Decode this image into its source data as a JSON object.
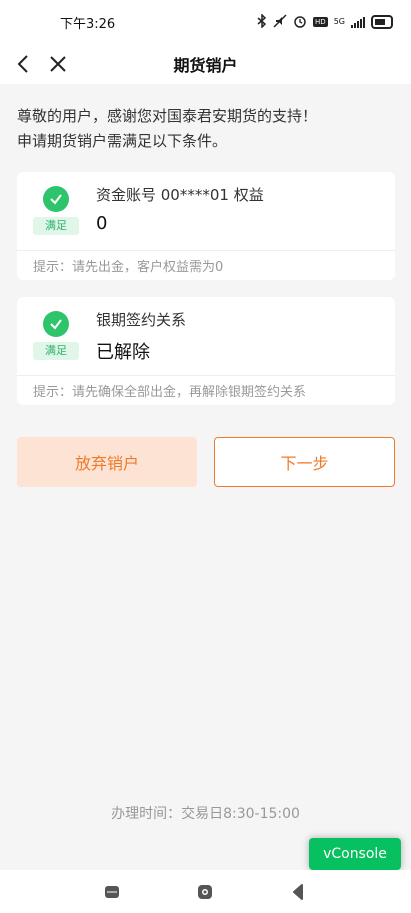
{
  "status_bar": {
    "time": "下午3:26",
    "network": "5G",
    "hd": "HD"
  },
  "nav": {
    "title": "期货销户",
    "back_icon": "back-arrow-icon",
    "close_icon": "close-icon"
  },
  "intro": {
    "line1": "尊敬的用户，感谢您对国泰君安期货的支持！",
    "line2": "申请期货销户需满足以下条件。"
  },
  "conditions": [
    {
      "label": "资金账号 00****01 权益",
      "value": "0",
      "status": "满足",
      "hint": "提示：请先出金，客户权益需为0"
    },
    {
      "label": "银期签约关系",
      "value": "已解除",
      "status": "满足",
      "hint": "提示：请先确保全部出金，再解除银期签约关系"
    }
  ],
  "buttons": {
    "abandon": "放弃销户",
    "next": "下一步"
  },
  "business_hours": "办理时间：交易日8:30-15:00",
  "vconsole": "vConsole",
  "colors": {
    "accent": "#ef7a2d",
    "success": "#2ec46b",
    "success_bg": "#dff6e8",
    "abandon_bg": "#fde3d3",
    "vconsole": "#07c160"
  }
}
